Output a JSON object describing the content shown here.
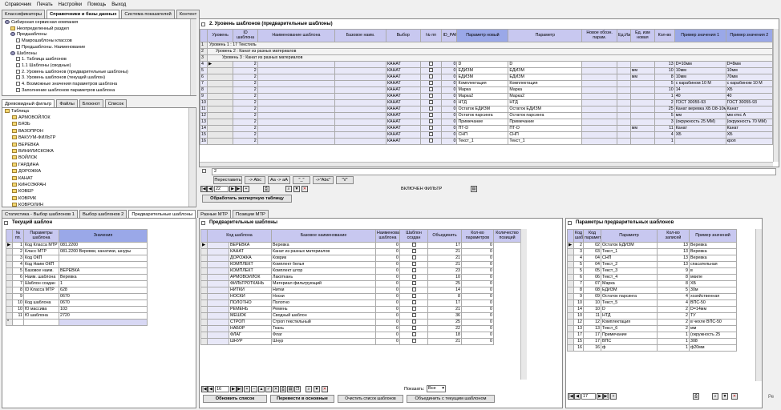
{
  "menu": [
    "Справочник",
    "Печать",
    "Настройки",
    "Помощь",
    "Выход"
  ],
  "top_tabs": [
    "Классификаторы",
    "Справочники и базы данных",
    "Система показателей",
    "Контент"
  ],
  "tree_top": [
    {
      "label": "Сибирская сервисная компания",
      "indent": 0,
      "icon": "gear"
    },
    {
      "label": "Неопределенный раздел",
      "indent": 1,
      "icon": "folder"
    },
    {
      "label": "Предшаблоны",
      "indent": 1,
      "icon": "gear"
    },
    {
      "label": "Макрошаблоны классов",
      "indent": 2,
      "icon": "doc"
    },
    {
      "label": "Предшаблоны. Наименование",
      "indent": 2,
      "icon": "doc"
    },
    {
      "label": "Шаблоны",
      "indent": 1,
      "icon": "gear"
    },
    {
      "label": "1. Таблица шаблонов",
      "indent": 2,
      "icon": "doc"
    },
    {
      "label": "1.1 Шаблоны (сводные)",
      "indent": 2,
      "icon": "doc"
    },
    {
      "label": "2. Уровень шаблонов (предварительные шаблоны)",
      "indent": 2,
      "icon": "doc"
    },
    {
      "label": "3. Уровень шаблонов (текущий шаблон)",
      "indent": 2,
      "icon": "doc"
    },
    {
      "label": "4. Возможные значения параметров шаблона",
      "indent": 2,
      "icon": "doc"
    },
    {
      "label": "Заполнение шаблонов параметров шаблона",
      "indent": 2,
      "icon": "doc"
    }
  ],
  "mid_tabs": [
    "Древовидный фильтр",
    "Файлы",
    "Блокнот",
    "Список"
  ],
  "tree_filter_root": "Таблица",
  "tree_filter": [
    "АРМОВОЙЛОК",
    "БЯЗЬ",
    "ВАЗОПРОН",
    "ВАКУУМ-ФИЛЬТР",
    "ВЕРЕВКА",
    "ВИНИЛИСКОЖА",
    "ВОЙЛОК",
    "ГАРДИНА",
    "ДОРОЖКА",
    "КАНАТ",
    "КИНОЭКРАН",
    "КОВЕР",
    "КОВРИК",
    "КОВРОЛИН"
  ],
  "main_title": "2. Уровень шаблонов (предварительные шаблоны)",
  "main_columns": [
    "Уровень",
    "ID шаблона",
    "Наименование шаблона",
    "Базовое наим.",
    "Выбор",
    "№ пп",
    "ID_PARAM",
    "Параметр новый",
    "Параметр",
    "Новое обозн. парам.",
    "Ед.Изм",
    "Ед. изм новая",
    "Кол-во",
    "Пример значения 1",
    "Пример значения 2"
  ],
  "main_groups": [
    "Уровень 1 : 17 Текстиль",
    "Уровень 2 : Канат из разных материалов",
    "Уровень 3 : Канат из разных материалов"
  ],
  "main_rows": [
    [
      "2",
      "",
      "",
      "КАНАТ",
      "",
      "0",
      "D",
      "D",
      "",
      "",
      "",
      "13",
      "D=10мм",
      "D=8мм"
    ],
    [
      "2",
      "",
      "",
      "КАНАТ",
      "",
      "0",
      "ЕДИЗМ",
      "ЕДИЗМ",
      "",
      "",
      "мм",
      "10",
      "10мм",
      "10мм"
    ],
    [
      "2",
      "",
      "",
      "КАНАТ",
      "",
      "0",
      "ЕДИЗМ",
      "ЕДИЗМ",
      "",
      "",
      "мм",
      "8",
      "10мм",
      "70мм"
    ],
    [
      "2",
      "",
      "",
      "КАНАТ",
      "",
      "0",
      "Комплектация",
      "Комплектация",
      "",
      "",
      "",
      "5",
      "с карабином 10 М",
      "с карабином 10 М"
    ],
    [
      "2",
      "",
      "",
      "КАНАТ",
      "",
      "0",
      "Марка",
      "Марка",
      "",
      "",
      "",
      "10",
      "14",
      "ХБ"
    ],
    [
      "2",
      "",
      "",
      "КАНАТ",
      "",
      "0",
      "Марка2",
      "Марка2",
      "",
      "",
      "",
      "1",
      "40",
      "40"
    ],
    [
      "2",
      "",
      "",
      "КАНАТ",
      "",
      "0",
      "НТД",
      "НТД",
      "",
      "",
      "",
      "2",
      "ГОСТ 30055-93",
      "ГОСТ 30055-93"
    ],
    [
      "2",
      "",
      "",
      "КАНАТ",
      "",
      "0",
      "Остаток ЕДИЗМ",
      "Остаток ЕДИЗМ",
      "",
      "",
      "",
      "25",
      "Канат веревка ХБ D8-10мм",
      "Канат"
    ],
    [
      "2",
      "",
      "",
      "КАНАТ",
      "",
      "0",
      "Остаток парсинга",
      "Остаток парсинга",
      "",
      "",
      "",
      "5",
      "мм",
      "мм кткс А"
    ],
    [
      "2",
      "",
      "",
      "КАНАТ",
      "",
      "0",
      "Примечание",
      "Примечание",
      "",
      "",
      "",
      "3",
      "(окружность 25 ММ)",
      "(окружность 70 ММ)"
    ],
    [
      "2",
      "",
      "",
      "КАНАТ",
      "",
      "0",
      "ПТ-D",
      "ПТ-D",
      "",
      "",
      "мм",
      "11",
      "Канат",
      "Канат"
    ],
    [
      "2",
      "",
      "",
      "КАНАТ",
      "",
      "0",
      "СНП",
      "СНП",
      "",
      "",
      "",
      "4",
      "ХБ",
      "ХБ"
    ],
    [
      "2",
      "",
      "",
      "КАНАТ",
      "",
      "0",
      "Текст_1",
      "Текст_1",
      "",
      "",
      "",
      "1",
      "",
      "кроп"
    ]
  ],
  "filter_value": "2",
  "toolbar_buttons": [
    "Переставить",
    "-> Abc",
    "Aa -> aA",
    "\"_\"",
    "->\"Abc\"",
    "\"\\/\""
  ],
  "main_nav_count": "22",
  "filter_status": "ВКЛЮЧЕН ФИЛЬТР",
  "process_button": "Обработать экспертную таблицу",
  "bottom_tabs": [
    "Статистика - Выбор шаблонов 1",
    "Выбор шаблонов 2",
    "Предварительные шаблоны",
    "Разные МТР",
    "Позиции МТР"
  ],
  "current_template": {
    "title": "Текущий шаблон",
    "columns": [
      "№ пп.",
      "Параметры шаблона",
      "Значения"
    ],
    "rows": [
      [
        "1",
        "Код Класса МТР",
        "081.2200"
      ],
      [
        "2",
        "Класс МТР",
        "081.2200 Веревки, канатики, шнуры"
      ],
      [
        "3",
        "Код ОКП",
        ""
      ],
      [
        "4",
        "Код Наим ОКП",
        ""
      ],
      [
        "5",
        "Базовое наим.",
        "ВЕРЕВКА"
      ],
      [
        "6",
        "Наим. шаблона",
        "Веревка"
      ],
      [
        "7",
        "Шаблон создан",
        "1"
      ],
      [
        "8",
        "ID Класса МТР",
        "628"
      ],
      [
        "9",
        "",
        "0670"
      ],
      [
        "10",
        "Код шаблона",
        "0670"
      ],
      [
        "10",
        "Ю массива",
        "103"
      ],
      [
        "11",
        "Ю шаблона",
        "2720"
      ]
    ]
  },
  "prelim": {
    "title": "Предварительные шаблоны",
    "columns": [
      "Код шаблона",
      "Базовое наименование",
      "Наименование шаблона",
      "Шаблон создан",
      "Объединить",
      "Кол-во параметров",
      "Количество позиций"
    ],
    "rows": [
      [
        "ВЕРЕВКА",
        "Веревка",
        "0",
        "17",
        "0"
      ],
      [
        "КАНАТ",
        "Канат из разных материалов",
        "0",
        "21",
        "0"
      ],
      [
        "ДОРОЖКА",
        "Коврик",
        "0",
        "21",
        "0"
      ],
      [
        "КОМПЛЕКТ",
        "Комплект белья",
        "0",
        "21",
        "0"
      ],
      [
        "КОМПЛЕКТ",
        "Комплект штор",
        "0",
        "23",
        "0"
      ],
      [
        "АРМОВОЙЛОК",
        "Лакоткань",
        "0",
        "10",
        "0"
      ],
      [
        "ФИЛЬТРОТКАНЬ",
        "Материал фильтрующий",
        "0",
        "25",
        "0"
      ],
      [
        "НИТКИ",
        "Нитки",
        "0",
        "14",
        "0"
      ],
      [
        "НОСКИ",
        "Носки",
        "0",
        "8",
        "0"
      ],
      [
        "ПОЛОТНО",
        "Полотно",
        "0",
        "17",
        "0"
      ],
      [
        "РЕМЕНЬ",
        "Ремень",
        "0",
        "21",
        "0"
      ],
      [
        "МЕШОК",
        "Сводный шаблон",
        "0",
        "36",
        "0"
      ],
      [
        "СТРОП",
        "Строп текстильный",
        "0",
        "25",
        "0"
      ],
      [
        "НАБОР",
        "Ткань",
        "0",
        "22",
        "0"
      ],
      [
        "ФЛАГ",
        "Флаг",
        "0",
        "18",
        "0"
      ],
      [
        "ШНУР",
        "Шнур",
        "0",
        "21",
        "0"
      ]
    ],
    "nav_count": "16",
    "show_label": "Показать:",
    "show_value": "Все",
    "buttons": [
      "Обновить список",
      "Перевести в основные",
      "Очистить список шаблонов",
      "Объединить с текущим шаблоном"
    ]
  },
  "params": {
    "title": "Параметры предварительных шаблонов",
    "columns": [
      "Код шаблона",
      "Код параметра",
      "Параметр",
      "Кол-во записей",
      "Пример значений"
    ],
    "rows": [
      [
        "2",
        "02",
        "Остаток ЕДИЗМ",
        "13",
        "Веревка"
      ],
      [
        "3",
        "03",
        "Текст_1",
        "13",
        "Веревка"
      ],
      [
        "4",
        "04",
        "СНП",
        "13",
        "Веревка"
      ],
      [
        "5",
        "04",
        "Текст_2",
        "13",
        "спасательная"
      ],
      [
        "5",
        "05",
        "Текст_3",
        "9",
        "в"
      ],
      [
        "6",
        "06",
        "Текст_4",
        "8",
        "мкиле"
      ],
      [
        "7",
        "07",
        "Марка",
        "8",
        "ХБ"
      ],
      [
        "8",
        "08",
        "ЕДИЗМ",
        "5",
        "30м"
      ],
      [
        "9",
        "09",
        "Остаток парсинга",
        "4",
        "хозяйственная"
      ],
      [
        "10",
        "10",
        "Текст_5",
        "4",
        "ВПС-50"
      ],
      [
        "14",
        "10",
        "D",
        "2",
        "D=14мм"
      ],
      [
        "10",
        "11",
        "НТД",
        "2",
        "ТУ"
      ],
      [
        "12",
        "12",
        "Комплектация",
        "2",
        "в чехле ВПС-50"
      ],
      [
        "13",
        "13",
        "Текст_6",
        "2",
        "мм"
      ],
      [
        "17",
        "17",
        "Примечание",
        "1",
        "(окружность 25"
      ],
      [
        "15",
        "17",
        "ВПС",
        "1",
        "308"
      ],
      [
        "16",
        "16",
        "ф",
        "1",
        "ф20мм"
      ]
    ],
    "nav_count": "17"
  },
  "corner_text": "Ре"
}
